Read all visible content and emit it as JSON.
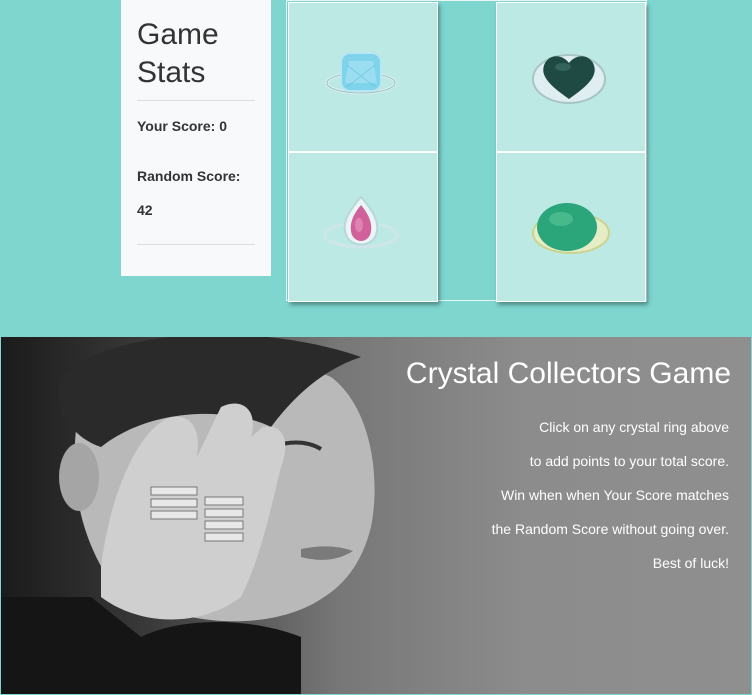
{
  "stats": {
    "title": "Game Stats",
    "your_score_label": "Your Score: 0",
    "random_score_label": "Random Score:",
    "random_score_value": "42"
  },
  "rings": [
    {
      "name": "aquamarine ring",
      "icon": "aquamarine-ring-icon",
      "color": "#7fd3ea"
    },
    {
      "name": "dark green heart ring",
      "icon": "heart-ring-icon",
      "color": "#1f4a44"
    },
    {
      "name": "pink pear ring",
      "icon": "pink-pear-ring-icon",
      "color": "#d0619a"
    },
    {
      "name": "green oval ring",
      "icon": "green-oval-ring-icon",
      "color": "#2aa67a"
    }
  ],
  "banner": {
    "title": "Crystal Collectors Game",
    "lines": [
      "Click on any crystal ring above",
      "to add points to your total score.",
      "Win when when Your Score matches",
      "the Random Score without going over.",
      "Best of luck!"
    ]
  },
  "colors": {
    "background": "#7ed6cf",
    "tile": "#bde9e5",
    "panel": "#f8f9fa"
  }
}
